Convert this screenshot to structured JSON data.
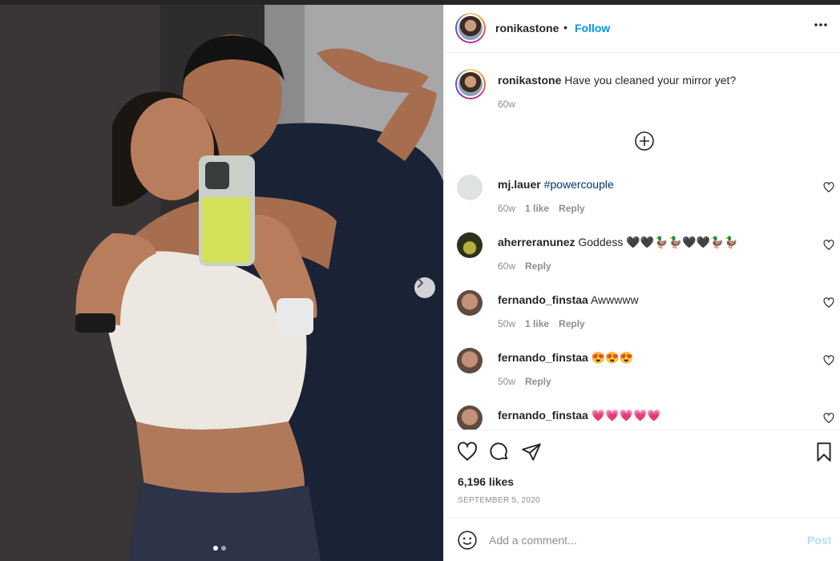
{
  "photo": {
    "alt_icon": "photo-mirror-selfie",
    "carousel_dots": 2,
    "active_dot": 0,
    "next_icon": "chevron-right-icon"
  },
  "header": {
    "username": "ronikastone",
    "separator": "•",
    "follow_label": "Follow",
    "more_icon": "more-options-icon",
    "more_label": "•••"
  },
  "caption": {
    "username": "ronikastone",
    "text": "Have you cleaned your mirror yet?",
    "time": "60w"
  },
  "load_more_icon": "plus-circle-icon",
  "comments": [
    {
      "username": "mj.lauer",
      "text": "",
      "hashtag": "#powercouple",
      "time": "60w",
      "likes": "1 like",
      "reply": "Reply",
      "avatar_color": "#dfe3df"
    },
    {
      "username": "aherreranunez",
      "text": "Goddess 🖤🖤🦆🦆🖤🖤🦆🦆",
      "hashtag": "",
      "time": "60w",
      "likes": "",
      "reply": "Reply",
      "avatar_color": "#3a3a1e"
    },
    {
      "username": "fernando_finstaa",
      "text": "Awwwww",
      "hashtag": "",
      "time": "50w",
      "likes": "1 like",
      "reply": "Reply",
      "avatar_color": "#8b6b58"
    },
    {
      "username": "fernando_finstaa",
      "text": "😍😍😍",
      "hashtag": "",
      "time": "50w",
      "likes": "",
      "reply": "Reply",
      "avatar_color": "#8b6b58"
    },
    {
      "username": "fernando_finstaa",
      "text": "💗💗💗💗💗",
      "hashtag": "",
      "time": "",
      "likes": "",
      "reply": "",
      "avatar_color": "#8b6b58"
    }
  ],
  "actions": {
    "like_icon": "heart-icon",
    "comment_icon": "comment-bubble-icon",
    "share_icon": "paper-plane-icon",
    "save_icon": "bookmark-icon",
    "likes": "6,196 likes",
    "date": "SEPTEMBER 5, 2020"
  },
  "add_comment": {
    "emoji_icon": "smiley-icon",
    "placeholder": "Add a comment...",
    "post_label": "Post"
  },
  "colors": {
    "link": "#0095f6",
    "hashtag": "#00376b",
    "muted": "#8e8e8e",
    "post_disabled": "#b2dffc"
  }
}
